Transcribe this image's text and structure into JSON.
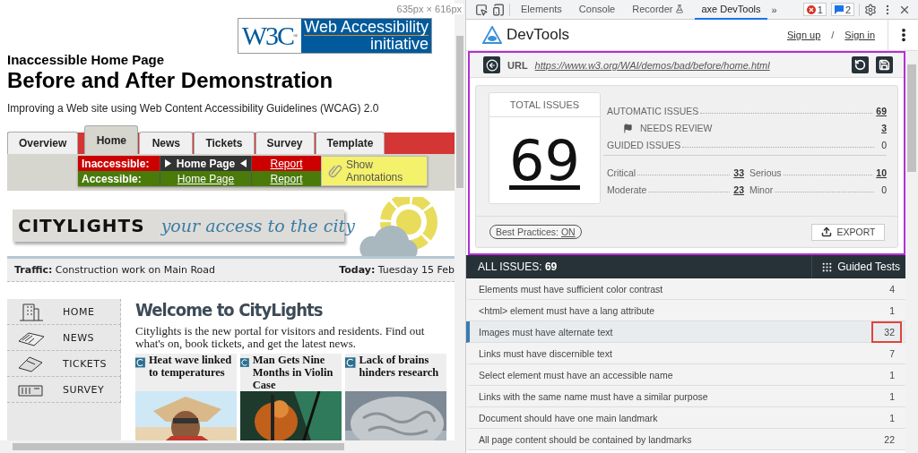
{
  "viewport_size": "635px × 616px",
  "page": {
    "logo": {
      "mark": "W3C",
      "registered": "®",
      "line1": "Web Accessibility",
      "line2": "initiative"
    },
    "kicker": "Inaccessible Home Page",
    "title": "Before and After Demonstration",
    "subtitle": "Improving a Web site using Web Content Accessibility Guidelines (WCAG) 2.0",
    "tabs": [
      {
        "label": "Overview",
        "selected": false
      },
      {
        "label": "Home",
        "selected": true
      },
      {
        "label": "News",
        "selected": false
      },
      {
        "label": "Tickets",
        "selected": false
      },
      {
        "label": "Survey",
        "selected": false
      },
      {
        "label": "Template",
        "selected": false
      }
    ],
    "versions": [
      {
        "kind": "inaccessible",
        "label": "Inaccessible:",
        "page": "Home Page",
        "current": true,
        "report": "Report"
      },
      {
        "kind": "accessible",
        "label": "Accessible:",
        "page": "Home Page",
        "current": false,
        "report": "Report"
      }
    ],
    "annotations_button": "Show Annotations",
    "site": {
      "brand": "CITYLIGHTS",
      "tagline": "your access to the city",
      "traffic_label": "Traffic:",
      "traffic": "Construction work on Main Road",
      "today_label": "Today:",
      "today": "Tuesday 15 Feb",
      "nav": [
        {
          "label": "HOME",
          "kind": "building"
        },
        {
          "label": "NEWS",
          "kind": "newspaper"
        },
        {
          "label": "TICKETS",
          "kind": "ticket"
        },
        {
          "label": "SURVEY",
          "kind": "survey"
        }
      ],
      "heading": "Welcome to CityLights",
      "intro": "Citylights is the new portal for visitors and residents. Find out what's on, book tickets, and get the latest news.",
      "news": [
        {
          "title": "Heat wave linked to temperatures",
          "kind": "person"
        },
        {
          "title": "Man Gets Nine Months in Violin Case",
          "kind": "violin"
        },
        {
          "title": "Lack of brains hinders research",
          "kind": "brain"
        }
      ]
    }
  },
  "devtools": {
    "tabs": [
      {
        "label": "Elements",
        "selected": false
      },
      {
        "label": "Console",
        "selected": false
      },
      {
        "label": "Recorder",
        "selected": false
      },
      {
        "label": "axe DevTools",
        "selected": true
      }
    ],
    "more": "»",
    "errors": "1",
    "messages": "2",
    "axe": {
      "brand": "DevTools",
      "sign_up": "Sign up",
      "separator": "/",
      "sign_in": "Sign in",
      "url_label": "URL",
      "url": "https://www.w3.org/WAI/demos/bad/before/home.html",
      "total_label": "TOTAL ISSUES",
      "total": "69",
      "stats": [
        {
          "label": "AUTOMATIC ISSUES",
          "value": "69",
          "linked": true,
          "kind": "main"
        },
        {
          "label": "NEEDS REVIEW",
          "value": "3",
          "linked": true,
          "kind": "review"
        },
        {
          "label": "GUIDED ISSUES",
          "value": "0",
          "linked": false,
          "kind": "main"
        }
      ],
      "severity": [
        {
          "label": "Critical",
          "value": "33",
          "linked": true
        },
        {
          "label": "Serious",
          "value": "10",
          "linked": true
        },
        {
          "label": "Moderate",
          "value": "23",
          "linked": true
        },
        {
          "label": "Minor",
          "value": "0",
          "linked": false
        }
      ],
      "best_practices_label": "Best Practices:",
      "best_practices": "ON",
      "export": "EXPORT",
      "all_issues_label": "ALL ISSUES:",
      "all_issues": "69",
      "guided_tests": "Guided Tests",
      "issues": [
        {
          "text": "Elements must have sufficient color contrast",
          "count": "4",
          "selected": false,
          "highlighted": false
        },
        {
          "text": "<html> element must have a lang attribute",
          "count": "1",
          "selected": false,
          "highlighted": false
        },
        {
          "text": "Images must have alternate text",
          "count": "32",
          "selected": true,
          "highlighted": true
        },
        {
          "text": "Links must have discernible text",
          "count": "7",
          "selected": false,
          "highlighted": false
        },
        {
          "text": "Select element must have an accessible name",
          "count": "1",
          "selected": false,
          "highlighted": false
        },
        {
          "text": "Links with the same name must have a similar purpose",
          "count": "1",
          "selected": false,
          "highlighted": false
        },
        {
          "text": "Document should have one main landmark",
          "count": "1",
          "selected": false,
          "highlighted": false
        },
        {
          "text": "All page content should be contained by landmarks",
          "count": "22",
          "selected": false,
          "highlighted": false
        }
      ]
    }
  }
}
